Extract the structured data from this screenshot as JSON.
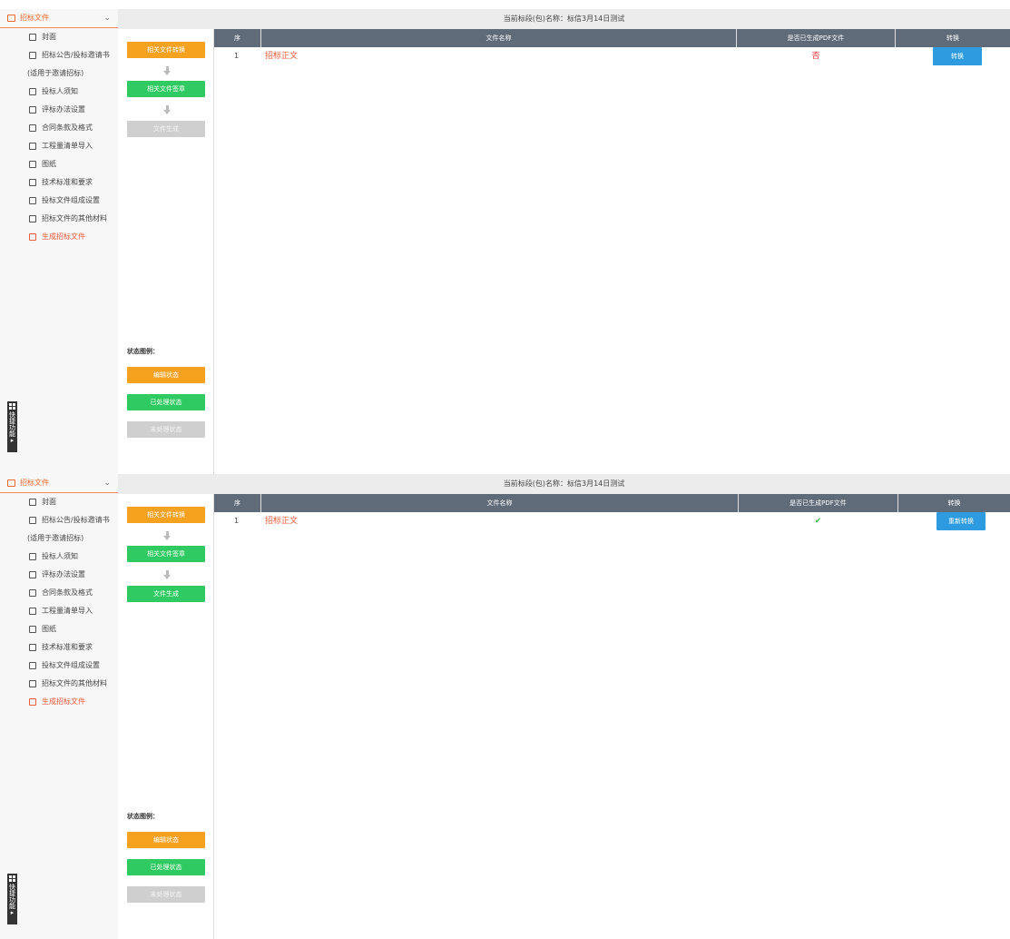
{
  "panels": [
    {
      "sidebar": {
        "header": "招标文件",
        "menu": [
          "封面",
          "招标公告/投标邀请书",
          "(适用于邀请招标)",
          "投标人须知",
          "评标办法设置",
          "合同条款及格式",
          "工程量清单导入",
          "图纸",
          "技术标准和要求",
          "投标文件组成设置",
          "招标文件的其他材料",
          "生成招标文件"
        ],
        "quick": "快捷功能"
      },
      "topbar": "当前标段(包)名称：标信3月14日测试",
      "workflow": {
        "step1": "相关文件转换",
        "step2": "相关文件签章",
        "step3": "文件生成",
        "step3_state": "gray"
      },
      "legend": {
        "title": "状态图例：",
        "edit": "编辑状态",
        "done": "已处理状态",
        "todo": "未处理状态"
      },
      "table": {
        "headers": [
          "序",
          "文件名称",
          "是否已生成PDF文件",
          "转换"
        ],
        "row": {
          "no": "1",
          "name": "招标正文",
          "pdf": "否",
          "action": "转换"
        }
      }
    },
    {
      "sidebar": {
        "header": "招标文件",
        "menu": [
          "封面",
          "招标公告/投标邀请书",
          "(适用于邀请招标)",
          "投标人须知",
          "评标办法设置",
          "合同条款及格式",
          "工程量清单导入",
          "图纸",
          "技术标准和要求",
          "投标文件组成设置",
          "招标文件的其他材料",
          "生成招标文件"
        ],
        "quick": "快捷功能"
      },
      "topbar": "当前标段(包)名称：标信3月14日测试",
      "workflow": {
        "step1": "相关文件转换",
        "step2": "相关文件签章",
        "step3": "文件生成",
        "step3_state": "green"
      },
      "legend": {
        "title": "状态图例：",
        "edit": "编辑状态",
        "done": "已处理状态",
        "todo": "未处理状态"
      },
      "table": {
        "headers": [
          "序",
          "文件名称",
          "是否已生成PDF文件",
          "转换"
        ],
        "row": {
          "no": "1",
          "name": "招标正文",
          "pdf": "✔",
          "action": "重新转换"
        }
      }
    }
  ],
  "colors": {
    "orange": "#f7a21e",
    "green": "#2fca62",
    "gray": "#cfcfcf",
    "header": "#5f6b79",
    "accent": "#ee5a3a",
    "blue": "#2e9be0"
  }
}
